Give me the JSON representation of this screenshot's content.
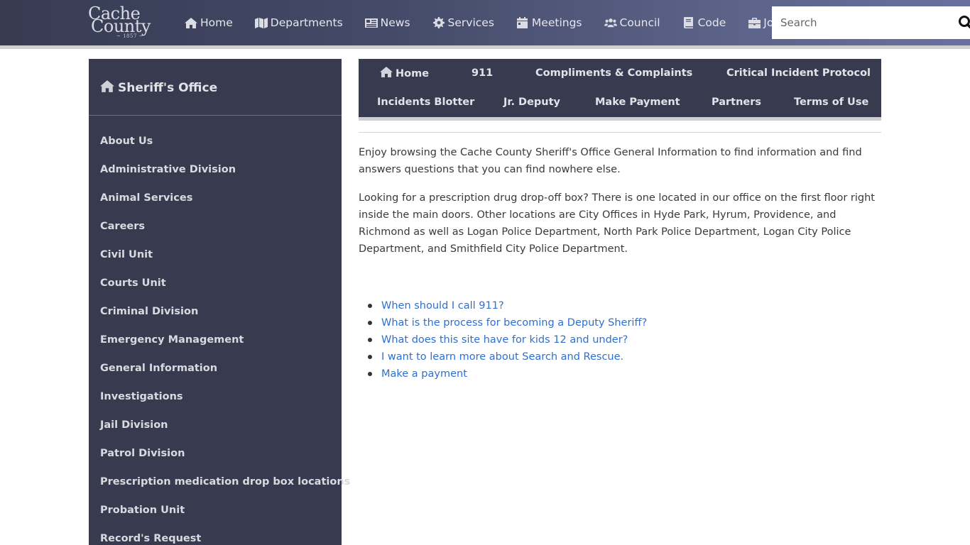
{
  "header": {
    "logo": {
      "line1": "Cache",
      "line2": "County",
      "year": "~ 1857 ~"
    },
    "nav": [
      {
        "label": "Home",
        "icon": "home-icon"
      },
      {
        "label": "Departments",
        "icon": "map-icon"
      },
      {
        "label": "News",
        "icon": "newspaper-icon"
      },
      {
        "label": "Services",
        "icon": "gear-icon"
      },
      {
        "label": "Meetings",
        "icon": "calendar-icon"
      },
      {
        "label": "Council",
        "icon": "users-icon"
      },
      {
        "label": "Code",
        "icon": "book-icon"
      },
      {
        "label": "Jobs",
        "icon": "briefcase-icon"
      }
    ],
    "search": {
      "placeholder": "Search",
      "value": "",
      "icon": "search-icon"
    }
  },
  "sidebar": {
    "title": "Sheriff's Office",
    "title_icon": "home-icon",
    "items": [
      "About Us",
      "Administrative Division",
      "Animal Services",
      "Careers",
      "Civil Unit",
      "Courts Unit",
      "Criminal Division",
      "Emergency Management",
      "General Information",
      "Investigations",
      "Jail Division",
      "Patrol Division",
      "Prescription medication drop box locations",
      "Probation Unit",
      "Record's Request"
    ]
  },
  "subnav": {
    "row1": [
      "Home",
      "911",
      "Compliments & Complaints",
      "Critical Incident Protocol"
    ],
    "row2": [
      "Incidents Blotter",
      "Jr. Deputy",
      "Make Payment",
      "Partners",
      "Terms of Use"
    ]
  },
  "main": {
    "paragraphs": [
      "Enjoy browsing the Cache County Sheriff's Office General Information to find information and find answers questions that you can find nowhere else.",
      "Looking for a prescription drug drop-off box? There is one located in our office on the first floor right inside the main doors. Other locations are City Offices in Hyde Park, Hyrum, Providence, and Richmond as well as Logan Police Department, North Park Police Department, Logan City Police Department, and Smithfield City Police Department."
    ],
    "links": [
      "When should I call 911?",
      "What is the process for becoming a Deputy Sheriff?",
      "What does this site have for kids 12 and under?",
      "I want to learn more about Search and Rescue.",
      "Make a payment"
    ]
  },
  "colors": {
    "header_dark": "#373b52",
    "header_light": "#6870a0",
    "panel": "#383b4f",
    "link": "#2f6fcf",
    "strip": "#cfcfcf"
  }
}
